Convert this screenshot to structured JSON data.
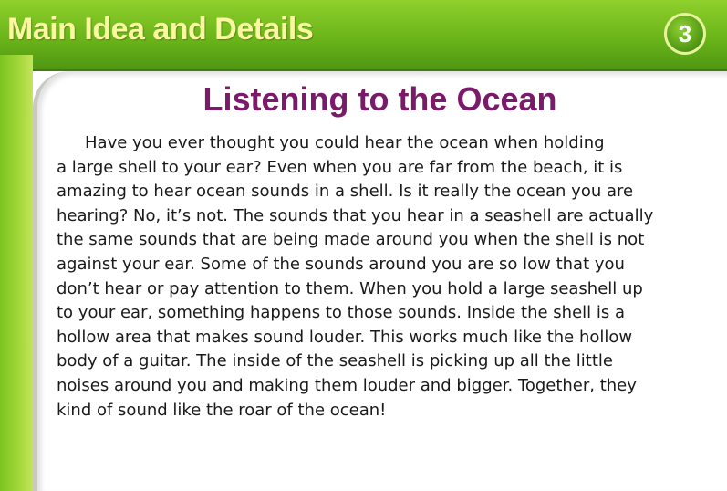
{
  "header": {
    "title": "Main Idea and Details",
    "number": "3"
  },
  "story": {
    "title": "Listening to the Ocean",
    "lines": [
      "Have you ever thought you could hear the ocean when holding",
      "a large shell to your ear? Even when you are far from the beach, it is",
      "amazing to hear ocean sounds in a shell. Is it really the ocean you are",
      "hearing? No, it’s not. The sounds that you hear in a seashell are actually",
      "the same sounds that are being made around you when the shell is not",
      "against your ear. Some of the sounds around you are so low that you",
      "don’t hear or pay attention to them. When you hold a large seashell up",
      "to your ear, something happens to those sounds. Inside the shell is a",
      "hollow area that makes sound louder. This works much like the hollow",
      "body of a guitar. The inside of the seashell is picking up all the little",
      "noises around you and making them louder and bigger. Together, they",
      "kind of sound like the roar of the ocean!"
    ]
  },
  "colors": {
    "header_green": "#6bb51a",
    "header_text": "#fbf7a0",
    "title_purple": "#7a1a6b"
  }
}
